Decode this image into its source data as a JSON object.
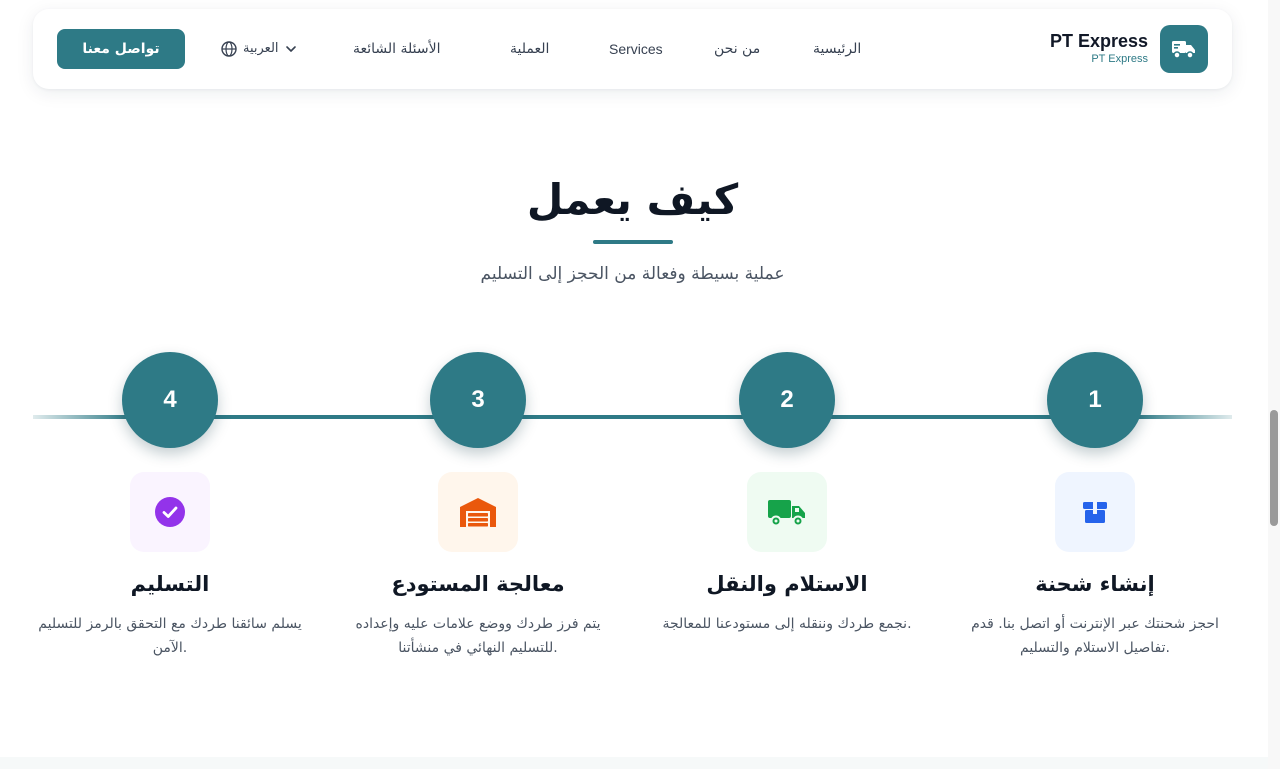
{
  "header": {
    "brand_name": "PT Express",
    "brand_sub": "PT Express",
    "nav": {
      "home": "الرئيسية",
      "about": "من نحن",
      "services": "Services",
      "process": "العملية",
      "faq": "الأسئلة الشائعة"
    },
    "language": "العربية",
    "contact_button": "تواصل معنا"
  },
  "section": {
    "title": "كيف يعمل",
    "subtitle": "عملية بسيطة وفعالة من الحجز إلى التسليم"
  },
  "steps": [
    {
      "number": "1",
      "title": "إنشاء شحنة",
      "description": "احجز شحنتك عبر الإنترنت أو اتصل بنا. قدم تفاصيل الاستلام والتسليم.",
      "icon": "box-icon",
      "icon_color": "#2563eb",
      "icon_bg": "#eff5ff"
    },
    {
      "number": "2",
      "title": "الاستلام والنقل",
      "description": "نجمع طردك وننقله إلى مستودعنا للمعالجة.",
      "icon": "truck-icon",
      "icon_color": "#16a34a",
      "icon_bg": "#effbf2"
    },
    {
      "number": "3",
      "title": "معالجة المستودع",
      "description": "يتم فرز طردك ووضع علامات عليه وإعداده للتسليم النهائي في منشأتنا.",
      "icon": "warehouse-icon",
      "icon_color": "#ea580c",
      "icon_bg": "#fff6ec"
    },
    {
      "number": "4",
      "title": "التسليم",
      "description": "يسلم سائقنا طردك مع التحقق بالرمز للتسليم الآمن.",
      "icon": "check-circle-icon",
      "icon_color": "#9333ea",
      "icon_bg": "#faf4ff"
    }
  ],
  "colors": {
    "accent": "#2e7a86",
    "heading": "#0f1724",
    "body_text": "#4b5563"
  }
}
